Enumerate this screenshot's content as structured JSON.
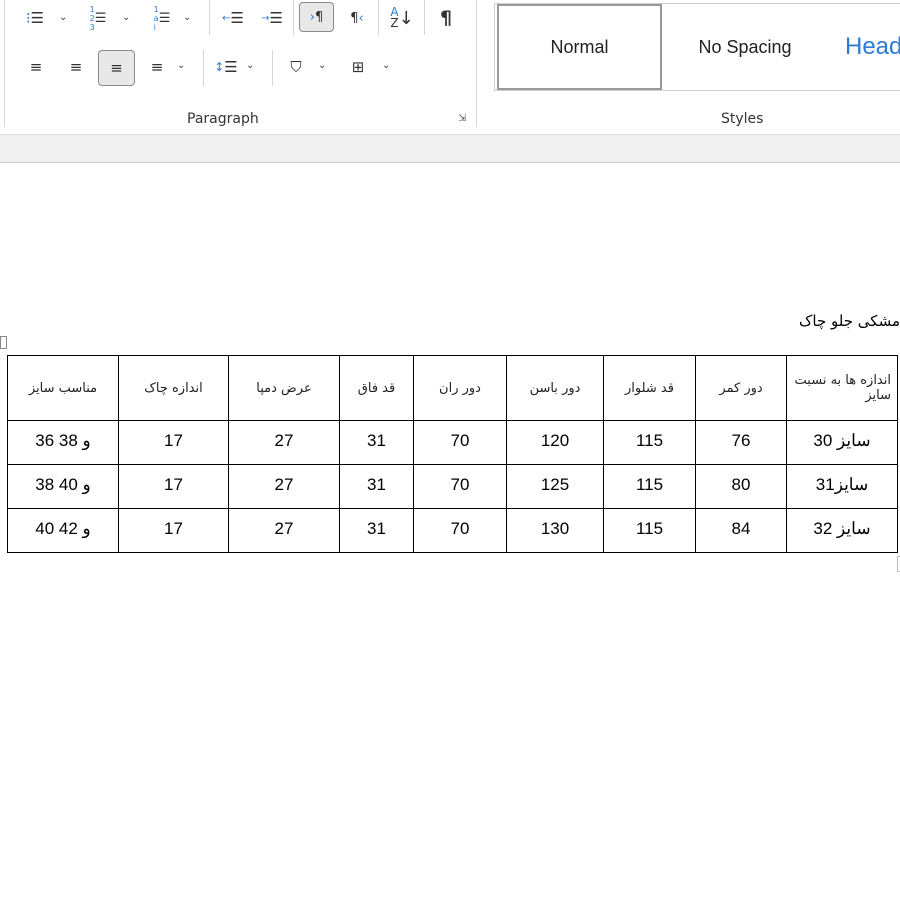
{
  "ribbon": {
    "paragraph_group_label": "Paragraph",
    "styles_group_label": "Styles",
    "styles": [
      "Normal",
      "No Spacing",
      "Head"
    ],
    "selected_style": "Normal",
    "icons": [
      "bullets-icon",
      "numbering-icon",
      "multilevel-list-icon",
      "decrease-indent-icon",
      "increase-indent-icon",
      "ltr-paragraph-icon",
      "rtl-paragraph-icon",
      "sort-icon",
      "show-formatting-icon",
      "align-left-icon",
      "center-icon",
      "align-right-icon",
      "justify-icon",
      "line-spacing-icon",
      "shading-icon",
      "borders-icon"
    ],
    "accent_color": "#2b7cd3"
  },
  "document": {
    "title": "مشکی جلو چاک",
    "table": {
      "headers": [
        "اندازه ها به نسبت سایز",
        "دور کمر",
        "قد شلوار",
        "دور باسن",
        "دور ران",
        "قد فاق",
        "عرض دمپا",
        "اندازه چاک",
        "مناسب سایز"
      ],
      "rows": [
        [
          "سایز 30",
          "76",
          "115",
          "120",
          "70",
          "31",
          "27",
          "17",
          "36 و 38"
        ],
        [
          "سایز31",
          "80",
          "115",
          "125",
          "70",
          "31",
          "27",
          "17",
          "38 و 40"
        ],
        [
          "سایز 32",
          "84",
          "115",
          "130",
          "70",
          "31",
          "27",
          "17",
          "40 و 42"
        ]
      ]
    }
  }
}
